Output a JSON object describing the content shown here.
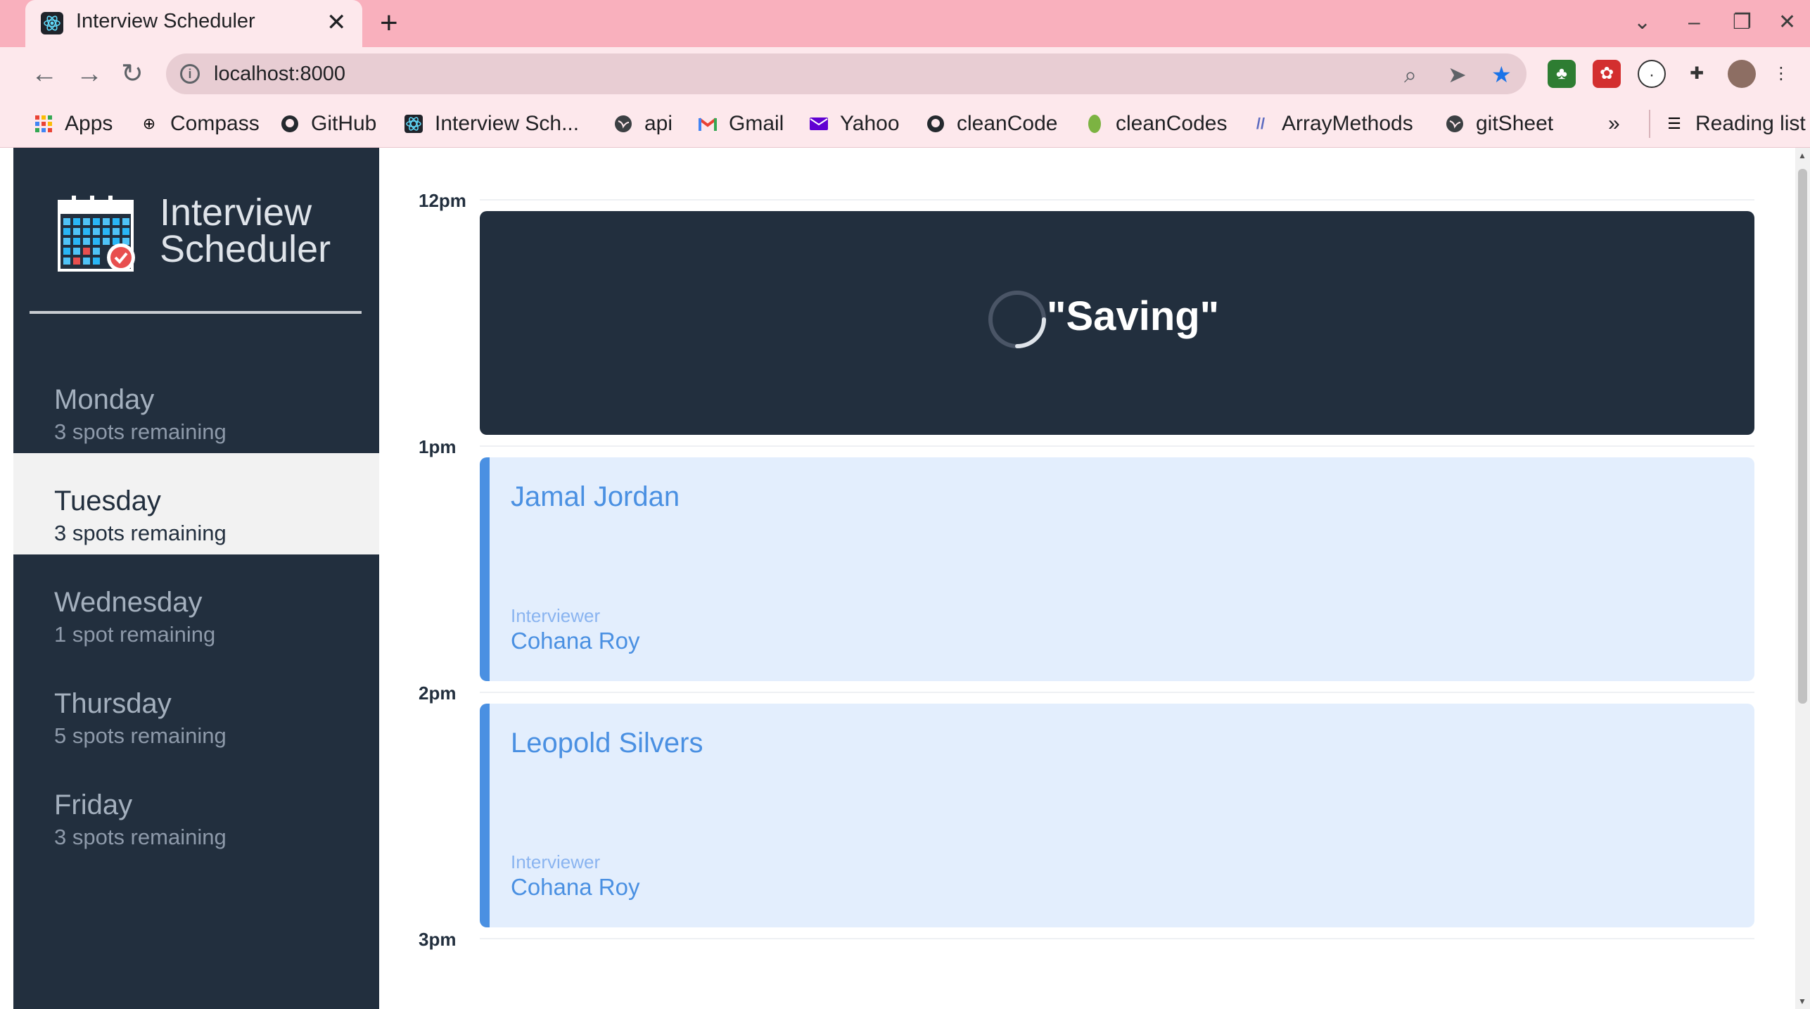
{
  "browser": {
    "tab_title": "Interview Scheduler",
    "tab_close": "✕",
    "new_tab": "+",
    "url": "localhost:8000",
    "bookmarks": [
      {
        "label": "Apps",
        "icon": "apps-grid-icon"
      },
      {
        "label": "Compass",
        "icon": "compass-icon"
      },
      {
        "label": "GitHub",
        "icon": "github-icon"
      },
      {
        "label": "Interview Sch...",
        "icon": "react-icon"
      },
      {
        "label": "api",
        "icon": "globe-icon"
      },
      {
        "label": "Gmail",
        "icon": "gmail-icon"
      },
      {
        "label": "Yahoo",
        "icon": "yahoo-mail-icon"
      },
      {
        "label": "cleanCode",
        "icon": "github-icon"
      },
      {
        "label": "cleanCodes",
        "icon": "leaf-icon"
      },
      {
        "label": "ArrayMethods",
        "icon": "code-icon"
      },
      {
        "label": "gitSheet",
        "icon": "globe-icon"
      }
    ],
    "more_bookmarks": "»",
    "reading_list": "Reading list"
  },
  "app": {
    "brand_line1": "Interview",
    "brand_line2": "Scheduler",
    "days": [
      {
        "name": "Monday",
        "spots": "3 spots remaining",
        "selected": false
      },
      {
        "name": "Tuesday",
        "spots": "3 spots remaining",
        "selected": true
      },
      {
        "name": "Wednesday",
        "spots": "1 spot remaining",
        "selected": false
      },
      {
        "name": "Thursday",
        "spots": "5 spots remaining",
        "selected": false
      },
      {
        "name": "Friday",
        "spots": "3 spots remaining",
        "selected": false
      }
    ],
    "hours": [
      "12pm",
      "1pm",
      "2pm",
      "3pm"
    ],
    "status_text": "\"Saving\"",
    "appointments": [
      {
        "student": "Jamal Jordan",
        "interviewer_label": "Interviewer",
        "interviewer": "Cohana Roy"
      },
      {
        "student": "Leopold Silvers",
        "interviewer_label": "Interviewer",
        "interviewer": "Cohana Roy"
      }
    ]
  },
  "colors": {
    "sidebar": "#222f3e",
    "accent": "#4a90e2",
    "appointment_bg": "#e3eefd",
    "tabbar": "#f9b0bd"
  }
}
